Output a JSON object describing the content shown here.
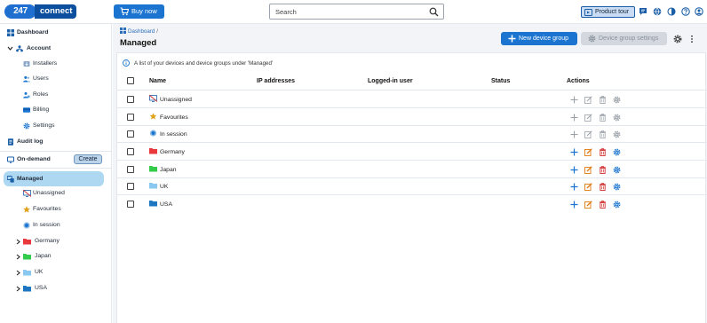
{
  "header": {
    "logo_number": "247",
    "logo_word": "connect",
    "buy_label": "Buy now",
    "search_placeholder": "Search",
    "tour_label": "Product tour"
  },
  "sidebar": {
    "dashboard": "Dashboard",
    "account": "Account",
    "account_items": [
      "Installers",
      "Users",
      "Roles",
      "Billing",
      "Settings"
    ],
    "audit_log": "Audit log",
    "on_demand": "On-demand",
    "create_label": "Create",
    "managed": "Managed",
    "managed_items": [
      {
        "label": "Unassigned",
        "icon": "unassigned-icon"
      },
      {
        "label": "Favourites",
        "icon": "star-icon"
      },
      {
        "label": "In session",
        "icon": "in-session-icon"
      },
      {
        "label": "Germany",
        "icon": "folder-icon",
        "color": "#e8383b"
      },
      {
        "label": "Japan",
        "icon": "folder-icon",
        "color": "#33cc4a"
      },
      {
        "label": "UK",
        "icon": "folder-icon",
        "color": "#8ac8f0"
      },
      {
        "label": "USA",
        "icon": "folder-icon",
        "color": "#1d76c2"
      }
    ]
  },
  "main": {
    "breadcrumb": "Dashboard",
    "title": "Managed",
    "new_group_label": "New device group",
    "group_settings_label": "Device group settings",
    "info_text": "A list of your devices and device groups under 'Managed'",
    "columns": [
      "Name",
      "IP addresses",
      "Logged-in user",
      "Status",
      "Actions"
    ],
    "rows": [
      {
        "name": "Unassigned",
        "icon": "unassigned-icon",
        "actions_enabled": false
      },
      {
        "name": "Favourites",
        "icon": "star-icon",
        "actions_enabled": false
      },
      {
        "name": "In session",
        "icon": "in-session-icon",
        "actions_enabled": false
      },
      {
        "name": "Germany",
        "icon": "folder-icon",
        "color": "#e8383b",
        "actions_enabled": true
      },
      {
        "name": "Japan",
        "icon": "folder-icon",
        "color": "#33cc4a",
        "actions_enabled": true
      },
      {
        "name": "UK",
        "icon": "folder-icon",
        "color": "#8ac8f0",
        "actions_enabled": true
      },
      {
        "name": "USA",
        "icon": "folder-icon",
        "color": "#1d76c2",
        "actions_enabled": true
      }
    ]
  },
  "colors": {
    "primary": "#1b75d0",
    "active_nav": "#aed7f2",
    "action_add": "#1b75d0",
    "action_edit": "#e07a12",
    "action_delete": "#d32f2f",
    "action_settings": "#1b75d0",
    "action_disabled": "#9aa0a8"
  }
}
